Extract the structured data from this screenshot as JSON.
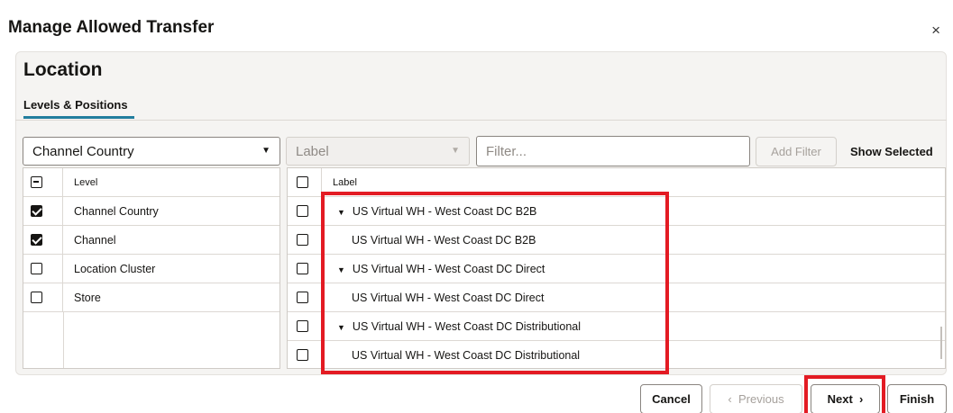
{
  "dialog": {
    "title": "Manage Allowed Transfer",
    "close": "×"
  },
  "section": {
    "title": "Location",
    "tab": "Levels & Positions"
  },
  "toolbar": {
    "level_dropdown": "Channel Country",
    "label_dropdown": "Label",
    "filter_placeholder": "Filter...",
    "add_filter": "Add Filter",
    "show_selected": "Show Selected"
  },
  "levels": {
    "header": "Level",
    "rows": [
      {
        "label": "Channel Country",
        "checked": true
      },
      {
        "label": "Channel",
        "checked": true
      },
      {
        "label": "Location Cluster",
        "checked": false
      },
      {
        "label": "Store",
        "checked": false
      }
    ]
  },
  "positions": {
    "header": "Label",
    "rows": [
      {
        "label": "US Virtual WH - West Coast DC B2B",
        "expandable": true
      },
      {
        "label": "US Virtual WH - West Coast DC B2B",
        "expandable": false
      },
      {
        "label": "US Virtual WH - West Coast DC Direct",
        "expandable": true
      },
      {
        "label": "US Virtual WH - West Coast DC Direct",
        "expandable": false
      },
      {
        "label": "US Virtual WH - West Coast DC Distributional",
        "expandable": true
      },
      {
        "label": "US Virtual WH - West Coast DC Distributional",
        "expandable": false
      }
    ]
  },
  "footer": {
    "cancel": "Cancel",
    "previous": "Previous",
    "next": "Next",
    "finish": "Finish"
  },
  "colors": {
    "highlight": "#e31b23",
    "tab_accent": "#227e9e"
  }
}
